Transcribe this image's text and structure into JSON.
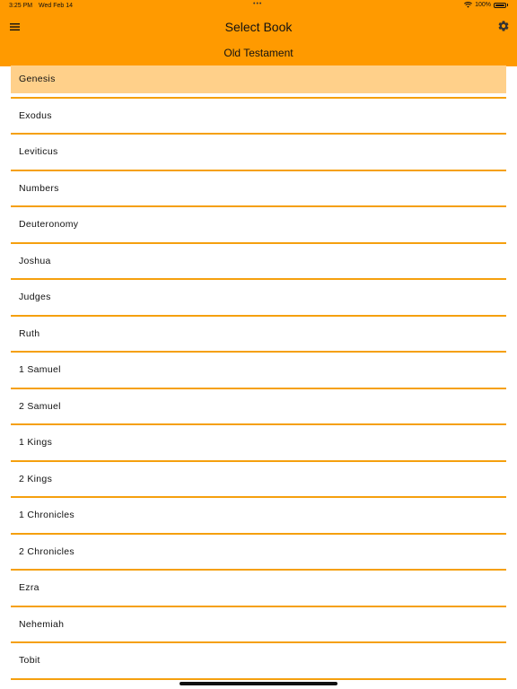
{
  "status_bar": {
    "time": "3:25 PM",
    "date": "Wed Feb 14",
    "dots": "•••",
    "battery_text": "100%"
  },
  "header": {
    "title": "Select Book",
    "section": "Old Testament"
  },
  "colors": {
    "accent": "#ff9a00",
    "selected_row": "#ffd08a",
    "divider": "#f5a00e"
  },
  "icons": {
    "menu": "hamburger-menu-icon",
    "settings": "gear-icon",
    "wifi": "wifi-icon",
    "battery": "battery-icon"
  },
  "books": [
    {
      "label": "Genesis",
      "selected": true
    },
    {
      "label": "Exodus"
    },
    {
      "label": "Leviticus"
    },
    {
      "label": "Numbers"
    },
    {
      "label": "Deuteronomy"
    },
    {
      "label": "Joshua"
    },
    {
      "label": "Judges"
    },
    {
      "label": "Ruth"
    },
    {
      "label": "1 Samuel"
    },
    {
      "label": "2 Samuel"
    },
    {
      "label": "1 Kings"
    },
    {
      "label": "2 Kings"
    },
    {
      "label": "1 Chronicles"
    },
    {
      "label": "2 Chronicles"
    },
    {
      "label": "Ezra"
    },
    {
      "label": "Nehemiah"
    },
    {
      "label": "Tobit"
    }
  ]
}
